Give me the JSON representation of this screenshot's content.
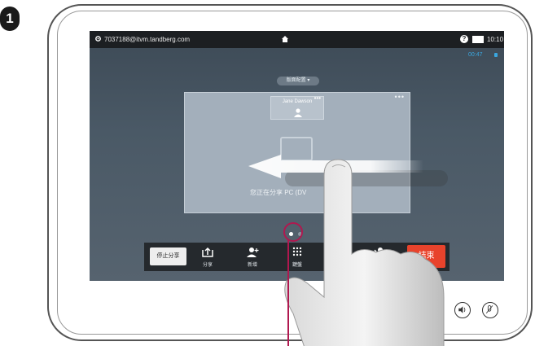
{
  "step": {
    "number": "1"
  },
  "statusbar": {
    "account": "7037188@itvm.tandberg.com",
    "clock": "10:10",
    "call_timer": "00:47"
  },
  "main": {
    "layout_button": "版面配置 ▾",
    "participant": "Jane Dawson",
    "more": "•••",
    "share_status": "您正在分享 PC (DV"
  },
  "toolbar": {
    "stop_share": "停止分享",
    "share": "分享",
    "add": "新增",
    "keypad": "鍵盤",
    "end_call": "結束"
  },
  "pagination": {
    "current_page": 1,
    "total_pages": 2
  },
  "icons": [
    "gear-icon",
    "home-icon",
    "help-icon",
    "camera-icon",
    "lock-icon",
    "person-icon",
    "pc-icon",
    "share-icon",
    "add-person-icon",
    "keypad-icon",
    "transfer-icon",
    "volume-icon",
    "mic-mute-icon",
    "swipe-left-arrow",
    "hand-pointer"
  ],
  "colors": {
    "end_call": "#e8432c",
    "timer": "#3aa7e0",
    "statusbar": "#1c1f22"
  }
}
